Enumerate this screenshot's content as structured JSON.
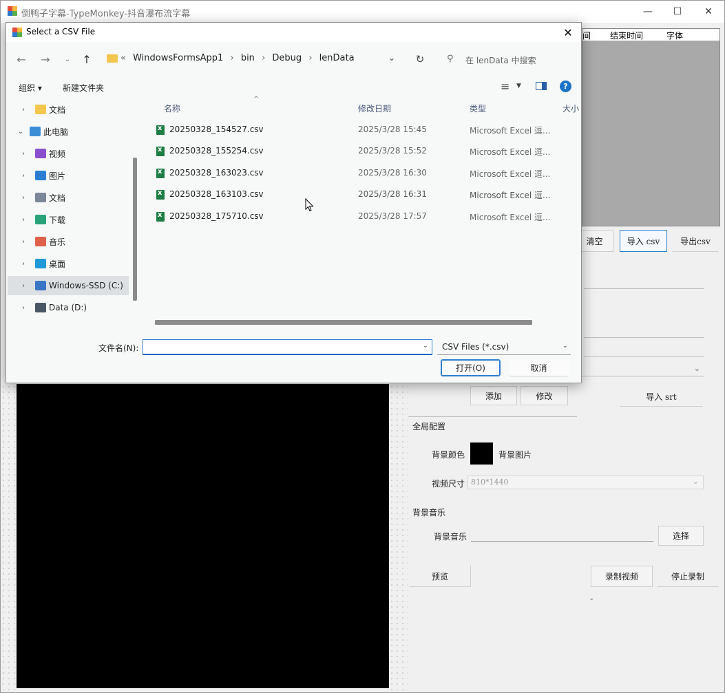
{
  "main_window": {
    "title": "倒鸭子字幕-TypeMonkey-抖音瀑布流字幕",
    "minimize_glyph": "—",
    "maximize_glyph": "☐",
    "close_glyph": "✕"
  },
  "grid": {
    "headers": [
      "间",
      "结束时间",
      "字体"
    ]
  },
  "right_panel": {
    "clear_button": "清空",
    "import_csv_button": "导入 csv",
    "export_csv_button": "导出csv",
    "add_button": "添加",
    "modify_button": "修改",
    "import_srt_button": "导入 srt",
    "global_config_label": "全局配置",
    "bg_color_label": "背景颜色",
    "bg_image_label": "背景图片",
    "video_size_label": "视频尺寸",
    "video_size_value": "810*1440",
    "bg_music_section": "背景音乐",
    "bg_music_label": "背景音乐",
    "select_button": "选择",
    "preview_button": "预览",
    "record_button": "录制视频",
    "stop_record_button": "停止录制",
    "dash": "-"
  },
  "dialog": {
    "title": "Select a CSV File",
    "breadcrumb": [
      "«",
      "WindowsFormsApp1",
      "›",
      "bin",
      "›",
      "Debug",
      "›",
      "lenData"
    ],
    "search_placeholder": "在 lenData 中搜索",
    "organize_label": "组织 ▾",
    "new_folder_label": "新建文件夹",
    "help_glyph": "?",
    "nav_items": [
      {
        "label": "文档",
        "expanded": false,
        "icon": "folder-icon",
        "color": "#f3c64e",
        "indent": 1
      },
      {
        "label": "此电脑",
        "expanded": true,
        "icon": "computer-icon",
        "color": "#3a8ed6",
        "indent": 0
      },
      {
        "label": "视频",
        "expanded": false,
        "icon": "video-icon",
        "color": "#8a4fcf",
        "indent": 1
      },
      {
        "label": "图片",
        "expanded": false,
        "icon": "picture-icon",
        "color": "#2a7fd3",
        "indent": 1
      },
      {
        "label": "文档",
        "expanded": false,
        "icon": "document-icon",
        "color": "#7c8797",
        "indent": 1
      },
      {
        "label": "下载",
        "expanded": false,
        "icon": "download-icon",
        "color": "#2aa37a",
        "indent": 1
      },
      {
        "label": "音乐",
        "expanded": false,
        "icon": "music-icon",
        "color": "#e0614a",
        "indent": 1
      },
      {
        "label": "桌面",
        "expanded": false,
        "icon": "desktop-icon",
        "color": "#1f9ad6",
        "indent": 1
      },
      {
        "label": "Windows-SSD (C:)",
        "expanded": false,
        "icon": "drive-c-icon",
        "color": "#3a76c4",
        "indent": 1,
        "selected": true
      },
      {
        "label": "Data (D:)",
        "expanded": false,
        "icon": "drive-d-icon",
        "color": "#4a5664",
        "indent": 1
      }
    ],
    "columns": [
      "名称",
      "修改日期",
      "类型",
      "大小"
    ],
    "files": [
      {
        "name": "20250328_154527.csv",
        "date": "2025/3/28 15:45",
        "type": "Microsoft Excel 逗..."
      },
      {
        "name": "20250328_155254.csv",
        "date": "2025/3/28 15:52",
        "type": "Microsoft Excel 逗..."
      },
      {
        "name": "20250328_163023.csv",
        "date": "2025/3/28 16:30",
        "type": "Microsoft Excel 逗..."
      },
      {
        "name": "20250328_163103.csv",
        "date": "2025/3/28 16:31",
        "type": "Microsoft Excel 逗..."
      },
      {
        "name": "20250328_175710.csv",
        "date": "2025/3/28 17:57",
        "type": "Microsoft Excel 逗..."
      }
    ],
    "filename_label": "文件名(N):",
    "filename_value": "",
    "filter_value": "CSV Files (*.csv)",
    "open_button": "打开(O)",
    "cancel_button": "取消"
  }
}
